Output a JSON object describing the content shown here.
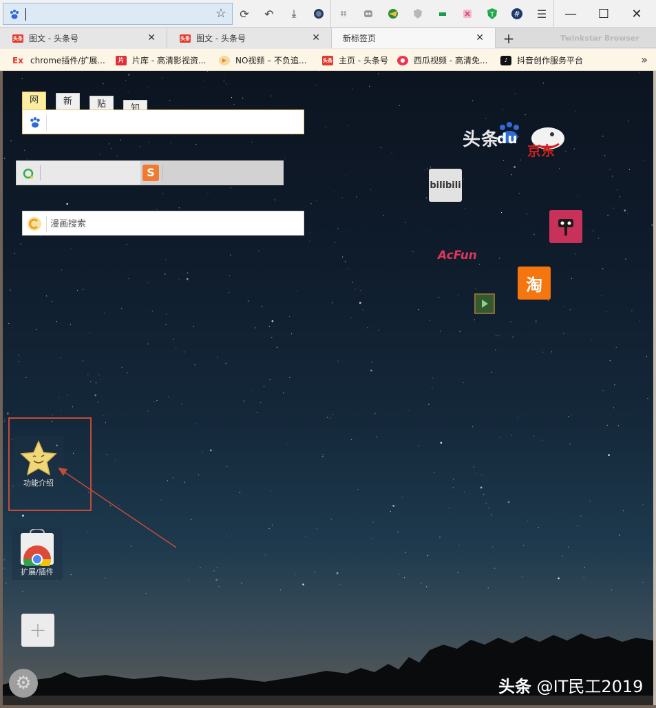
{
  "address": {
    "value": "",
    "star_icon": "bookmark-star-icon"
  },
  "tabs": [
    {
      "label": "图文 - 头条号",
      "favicon": "头条",
      "close": "✕"
    },
    {
      "label": "图文 - 头条号",
      "favicon": "头条",
      "close": "✕"
    },
    {
      "label": "新标签页",
      "favicon": "",
      "close": "✕",
      "active": true
    }
  ],
  "new_tab": "+",
  "browser_brand": "Twinkstar Browser",
  "bookmarks": [
    {
      "label": "chrome插件/扩展...",
      "icon": "Ex",
      "color": "#e23c2f"
    },
    {
      "label": "片库 - 高清影视资...",
      "icon": "片",
      "color": "#e0303a"
    },
    {
      "label": "NO视频 – 不负追...",
      "icon": "▶",
      "color": "#f0a030"
    },
    {
      "label": "主页 - 头条号",
      "icon": "头条",
      "color": "#e23c2f"
    },
    {
      "label": "西瓜视频 - 高清免...",
      "icon": "●",
      "color": "#f03250"
    },
    {
      "label": "抖音创作服务平台",
      "icon": "♪",
      "color": "#111111"
    }
  ],
  "bookmarks_more": "»",
  "search": {
    "tabs": [
      "网页",
      "新闻",
      "贴吧",
      "知道"
    ],
    "manhua_placeholder": "漫画搜索"
  },
  "sites": {
    "toutiao": "头条",
    "baidu": "du",
    "jd": "京东",
    "bilibili": "bilibili",
    "acfun": "AcFun",
    "taobao": "淘"
  },
  "dock": {
    "feature_intro": "功能介绍",
    "extensions": "扩展/插件",
    "add": "+"
  },
  "watermark": {
    "brand": "头条",
    "handle": "@IT民工2019"
  }
}
